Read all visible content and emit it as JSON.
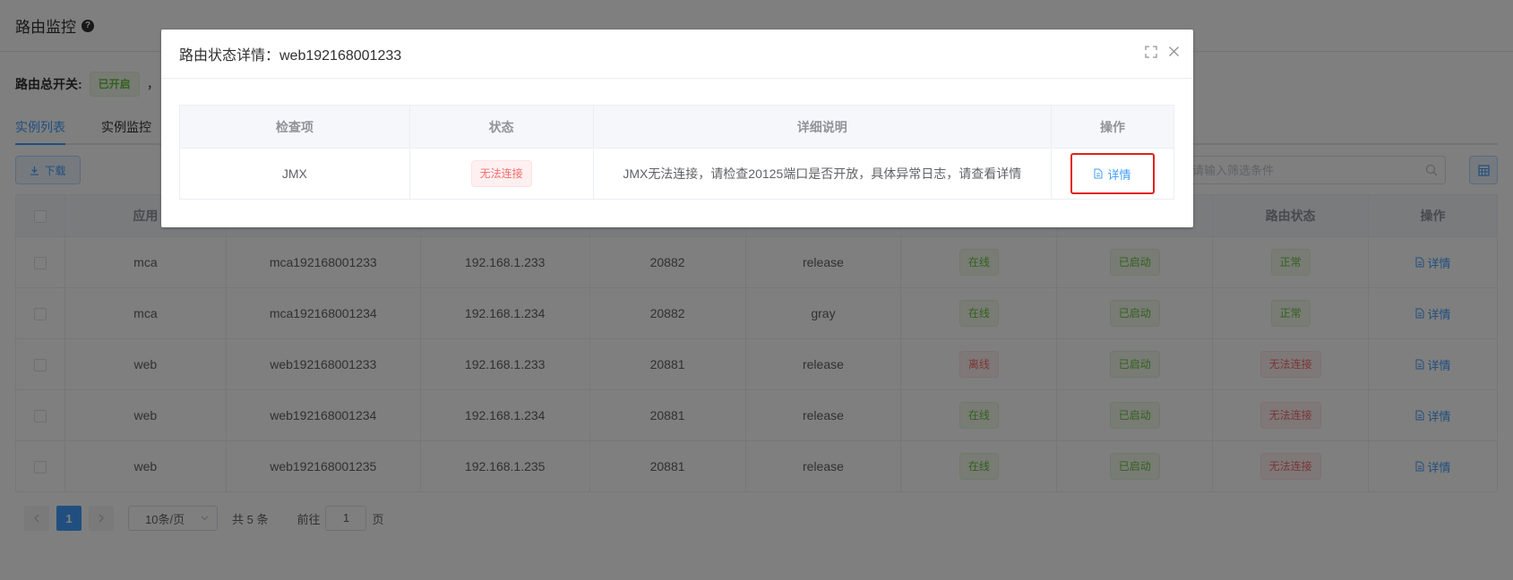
{
  "page": {
    "title": "路由监控",
    "switch_label": "路由总开关:",
    "switch_status": "已开启",
    "switch_suffix": "，",
    "tabs": [
      {
        "label": "实例列表",
        "active": true
      },
      {
        "label": "实例监控",
        "active": false
      }
    ],
    "download_label": "下载",
    "search_placeholder": "请输入筛选条件",
    "table": {
      "headers": [
        "应用",
        "",
        "",
        "",
        "",
        "",
        "",
        "路由状态",
        "操作"
      ],
      "rows": [
        {
          "app": "mca",
          "instance": "mca192168001233",
          "ip": "192.168.1.233",
          "port": "20882",
          "env": "release",
          "online": "在线",
          "started": "已启动",
          "route": "正常",
          "action": "详情"
        },
        {
          "app": "mca",
          "instance": "mca192168001234",
          "ip": "192.168.1.234",
          "port": "20882",
          "env": "gray",
          "online": "在线",
          "started": "已启动",
          "route": "正常",
          "action": "详情"
        },
        {
          "app": "web",
          "instance": "web192168001233",
          "ip": "192.168.1.233",
          "port": "20881",
          "env": "release",
          "online": "离线",
          "started": "已启动",
          "route": "无法连接",
          "action": "详情"
        },
        {
          "app": "web",
          "instance": "web192168001234",
          "ip": "192.168.1.234",
          "port": "20881",
          "env": "release",
          "online": "在线",
          "started": "已启动",
          "route": "无法连接",
          "action": "详情"
        },
        {
          "app": "web",
          "instance": "web192168001235",
          "ip": "192.168.1.235",
          "port": "20881",
          "env": "release",
          "online": "在线",
          "started": "已启动",
          "route": "无法连接",
          "action": "详情"
        }
      ]
    },
    "pagination": {
      "current_page": "1",
      "page_size": "10条/页",
      "total": "共 5 条",
      "goto_prefix": "前往",
      "goto_value": "1",
      "goto_suffix": "页"
    }
  },
  "modal": {
    "title": "路由状态详情：web192168001233",
    "table": {
      "headers": [
        "检查项",
        "状态",
        "详细说明",
        "操作"
      ],
      "rows": [
        {
          "item": "JMX",
          "status": "无法连接",
          "description": "JMX无法连接，请检查20125端口是否开放，具体异常日志，请查看详情",
          "action": "详情"
        }
      ]
    }
  },
  "colors": {
    "primary": "#409eff",
    "success": "#67c23a",
    "danger": "#f56c6c",
    "highlight_border": "#e0221b"
  }
}
